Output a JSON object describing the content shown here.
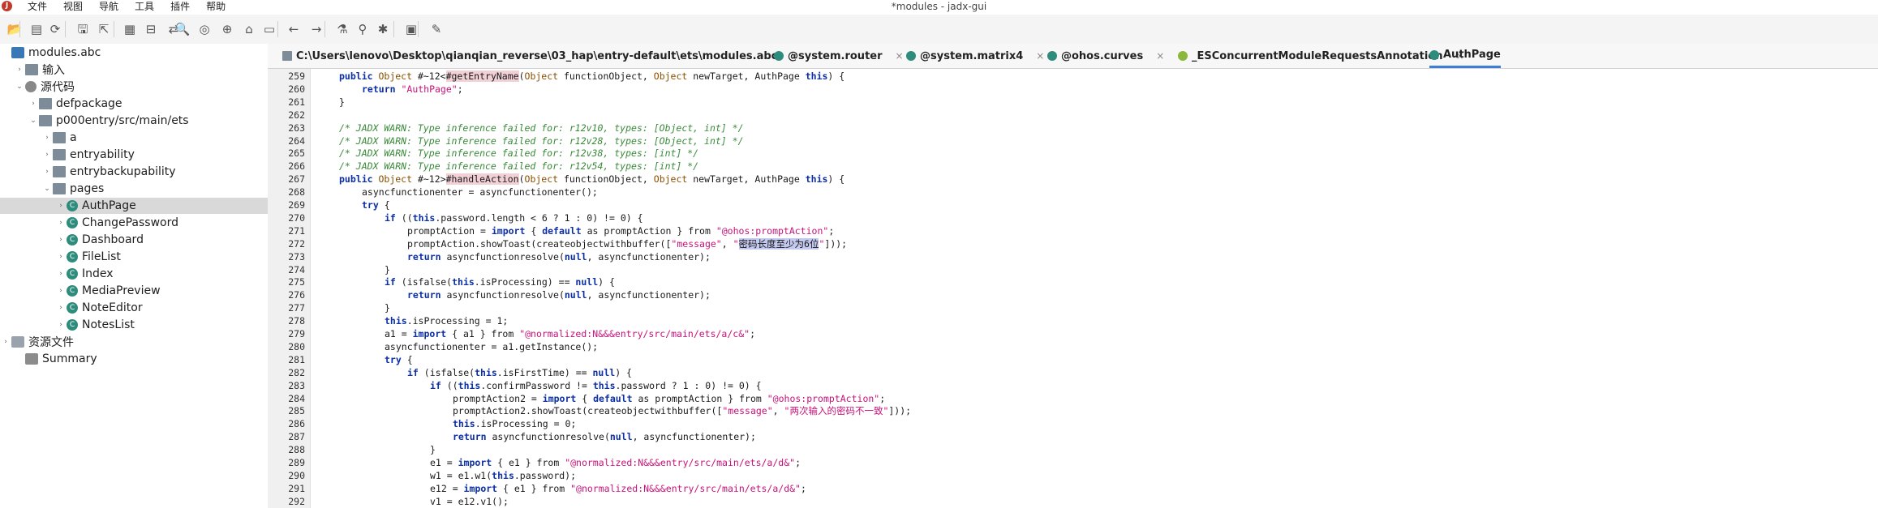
{
  "window": {
    "title": "*modules - jadx-gui",
    "app_icon_letter": "J"
  },
  "menu": [
    "文件",
    "视图",
    "导航",
    "工具",
    "插件",
    "帮助"
  ],
  "toolbar_icons": [
    "open-file-icon",
    "add-files-icon",
    "reload-icon",
    "save-all-icon",
    "export-icon",
    "preferences-icon",
    "flatten-packages-icon",
    "sync-tree-icon",
    "search-icon",
    "find-class-icon",
    "find-usages-icon",
    "home-icon",
    "log-viewer-icon",
    "back-icon",
    "forward-icon",
    "quark-icon",
    "deobfuscation-icon",
    "debug-icon",
    "decompile-all-icon",
    "settings-icon"
  ],
  "sidebar": {
    "items": [
      {
        "label": "modules.abc",
        "icon": "file",
        "arrow": "",
        "indent": 0
      },
      {
        "label": "输入",
        "icon": "folder",
        "arrow": "›",
        "indent": 1
      },
      {
        "label": "源代码",
        "icon": "gear",
        "arrow": "⌄",
        "indent": 1
      },
      {
        "label": "defpackage",
        "icon": "folder",
        "arrow": "›",
        "indent": 2
      },
      {
        "label": "p000entry/src/main/ets",
        "icon": "folder",
        "arrow": "⌄",
        "indent": 2
      },
      {
        "label": "a",
        "icon": "folder",
        "arrow": "›",
        "indent": 3
      },
      {
        "label": "entryability",
        "icon": "folder",
        "arrow": "›",
        "indent": 3
      },
      {
        "label": "entrybackupability",
        "icon": "folder",
        "arrow": "›",
        "indent": 3
      },
      {
        "label": "pages",
        "icon": "folder",
        "arrow": "⌄",
        "indent": 3
      },
      {
        "label": "AuthPage",
        "icon": "cls",
        "arrow": "›",
        "indent": 4,
        "selected": true
      },
      {
        "label": "ChangePassword",
        "icon": "cls",
        "arrow": "›",
        "indent": 4
      },
      {
        "label": "Dashboard",
        "icon": "cls",
        "arrow": "›",
        "indent": 4
      },
      {
        "label": "FileList",
        "icon": "cls",
        "arrow": "›",
        "indent": 4
      },
      {
        "label": "Index",
        "icon": "cls",
        "arrow": "›",
        "indent": 4
      },
      {
        "label": "MediaPreview",
        "icon": "cls",
        "arrow": "›",
        "indent": 4
      },
      {
        "label": "NoteEditor",
        "icon": "cls",
        "arrow": "›",
        "indent": 4
      },
      {
        "label": "NotesList",
        "icon": "cls",
        "arrow": "›",
        "indent": 4
      },
      {
        "label": "资源文件",
        "icon": "res",
        "arrow": "›",
        "indent": 0
      },
      {
        "label": "Summary",
        "icon": "sum",
        "arrow": "",
        "indent": 1
      }
    ]
  },
  "tabs": [
    {
      "label": "C:\\Users\\lenovo\\Desktop\\qianqian_reverse\\03_hap\\entry-default\\ets\\modules.abc",
      "icon_color": "#7e8b99",
      "close": "×"
    },
    {
      "label": "@system.router",
      "icon_color": "#2e8c7c",
      "close": "×"
    },
    {
      "label": "@system.matrix4",
      "icon_color": "#2e8c7c",
      "close": "×"
    },
    {
      "label": "@ohos.curves",
      "icon_color": "#2e8c7c",
      "close": "×"
    },
    {
      "label": "_ESConcurrentModuleRequestsAnnotation",
      "icon_color": "#8bb73a",
      "close": "×"
    },
    {
      "label": "AuthPage",
      "icon_color": "#2e8c7c",
      "close": "",
      "active": true
    }
  ],
  "code_lines": [
    {
      "n": "259",
      "indent": 4,
      "segs": [
        [
          "kw",
          "public "
        ],
        [
          "ty",
          "Object "
        ],
        [
          "t",
          "#~12<"
        ],
        [
          "hl",
          "#getEntryName"
        ],
        [
          "t",
          "("
        ],
        [
          "ty",
          "Object "
        ],
        [
          "t",
          "functionObject, "
        ],
        [
          "ty",
          "Object "
        ],
        [
          "t",
          "newTarget, AuthPage "
        ],
        [
          "kw",
          "this"
        ],
        [
          "t",
          ") {"
        ]
      ]
    },
    {
      "n": "260",
      "indent": 8,
      "segs": [
        [
          "kw",
          "return "
        ],
        [
          "st",
          "\"AuthPage\""
        ],
        [
          "t",
          ";"
        ]
      ]
    },
    {
      "n": "261",
      "indent": 4,
      "segs": [
        [
          "t",
          "}"
        ]
      ]
    },
    {
      "n": "262",
      "indent": 0,
      "segs": []
    },
    {
      "n": "263",
      "indent": 4,
      "segs": [
        [
          "cm",
          "/* JADX WARN: Type inference failed for: r12v10, types: [Object, int] */"
        ]
      ]
    },
    {
      "n": "264",
      "indent": 4,
      "segs": [
        [
          "cm",
          "/* JADX WARN: Type inference failed for: r12v28, types: [Object, int] */"
        ]
      ]
    },
    {
      "n": "265",
      "indent": 4,
      "segs": [
        [
          "cm",
          "/* JADX WARN: Type inference failed for: r12v38, types: [int] */"
        ]
      ]
    },
    {
      "n": "266",
      "indent": 4,
      "segs": [
        [
          "cm",
          "/* JADX WARN: Type inference failed for: r12v54, types: [int] */"
        ]
      ]
    },
    {
      "n": "267",
      "indent": 4,
      "segs": [
        [
          "kw",
          "public "
        ],
        [
          "ty",
          "Object "
        ],
        [
          "t",
          "#~12>"
        ],
        [
          "hl",
          "#handleAction"
        ],
        [
          "t",
          "("
        ],
        [
          "ty",
          "Object "
        ],
        [
          "t",
          "functionObject, "
        ],
        [
          "ty",
          "Object "
        ],
        [
          "t",
          "newTarget, AuthPage "
        ],
        [
          "kw",
          "this"
        ],
        [
          "t",
          ") {"
        ]
      ]
    },
    {
      "n": "268",
      "indent": 8,
      "segs": [
        [
          "t",
          "asyncfunctionenter = asyncfunctionenter();"
        ]
      ]
    },
    {
      "n": "269",
      "indent": 8,
      "segs": [
        [
          "kw",
          "try "
        ],
        [
          "t",
          "{"
        ]
      ]
    },
    {
      "n": "270",
      "indent": 12,
      "segs": [
        [
          "kw",
          "if "
        ],
        [
          "t",
          "(("
        ],
        [
          "kw",
          "this"
        ],
        [
          "t",
          ".password.length < 6 ? 1 : 0) != 0) {"
        ]
      ]
    },
    {
      "n": "271",
      "indent": 16,
      "segs": [
        [
          "t",
          "promptAction = "
        ],
        [
          "kw",
          "import "
        ],
        [
          "t",
          "{ "
        ],
        [
          "kw",
          "default "
        ],
        [
          "t",
          "as promptAction } from "
        ],
        [
          "st",
          "\"@ohos:promptAction\""
        ],
        [
          "t",
          ";"
        ]
      ]
    },
    {
      "n": "272",
      "indent": 16,
      "segs": [
        [
          "t",
          "promptAction.showToast(createobjectwithbuffer(["
        ],
        [
          "st",
          "\"message\""
        ],
        [
          "t",
          ", "
        ],
        [
          "st",
          "\""
        ],
        [
          "ss",
          "密码长度至少为6位"
        ],
        [
          "st",
          "\""
        ],
        [
          "t",
          "]));"
        ]
      ]
    },
    {
      "n": "273",
      "indent": 16,
      "segs": [
        [
          "kw",
          "return "
        ],
        [
          "t",
          "asyncfunctionresolve("
        ],
        [
          "kw",
          "null"
        ],
        [
          "t",
          ", asyncfunctionenter);"
        ]
      ]
    },
    {
      "n": "274",
      "indent": 12,
      "segs": [
        [
          "t",
          "}"
        ]
      ]
    },
    {
      "n": "275",
      "indent": 12,
      "segs": [
        [
          "kw",
          "if "
        ],
        [
          "t",
          "(isfalse("
        ],
        [
          "kw",
          "this"
        ],
        [
          "t",
          ".isProcessing) == "
        ],
        [
          "kw",
          "null"
        ],
        [
          "t",
          ") {"
        ]
      ]
    },
    {
      "n": "276",
      "indent": 16,
      "segs": [
        [
          "kw",
          "return "
        ],
        [
          "t",
          "asyncfunctionresolve("
        ],
        [
          "kw",
          "null"
        ],
        [
          "t",
          ", asyncfunctionenter);"
        ]
      ]
    },
    {
      "n": "277",
      "indent": 12,
      "segs": [
        [
          "t",
          "}"
        ]
      ]
    },
    {
      "n": "278",
      "indent": 12,
      "segs": [
        [
          "kw",
          "this"
        ],
        [
          "t",
          ".isProcessing = 1;"
        ]
      ]
    },
    {
      "n": "279",
      "indent": 12,
      "segs": [
        [
          "t",
          "a1 = "
        ],
        [
          "kw",
          "import "
        ],
        [
          "t",
          "{ a1 } from "
        ],
        [
          "st",
          "\"@normalized:N&&&entry/src/main/ets/a/c&\""
        ],
        [
          "t",
          ";"
        ]
      ]
    },
    {
      "n": "280",
      "indent": 12,
      "segs": [
        [
          "t",
          "asyncfunctionenter = a1.getInstance();"
        ]
      ]
    },
    {
      "n": "281",
      "indent": 12,
      "segs": [
        [
          "kw",
          "try "
        ],
        [
          "t",
          "{"
        ]
      ]
    },
    {
      "n": "282",
      "indent": 16,
      "segs": [
        [
          "kw",
          "if "
        ],
        [
          "t",
          "(isfalse("
        ],
        [
          "kw",
          "this"
        ],
        [
          "t",
          ".isFirstTime) == "
        ],
        [
          "kw",
          "null"
        ],
        [
          "t",
          ") {"
        ]
      ]
    },
    {
      "n": "283",
      "indent": 20,
      "segs": [
        [
          "kw",
          "if "
        ],
        [
          "t",
          "(("
        ],
        [
          "kw",
          "this"
        ],
        [
          "t",
          ".confirmPassword != "
        ],
        [
          "kw",
          "this"
        ],
        [
          "t",
          ".password ? 1 : 0) != 0) {"
        ]
      ]
    },
    {
      "n": "284",
      "indent": 24,
      "segs": [
        [
          "t",
          "promptAction2 = "
        ],
        [
          "kw",
          "import "
        ],
        [
          "t",
          "{ "
        ],
        [
          "kw",
          "default "
        ],
        [
          "t",
          "as promptAction } from "
        ],
        [
          "st",
          "\"@ohos:promptAction\""
        ],
        [
          "t",
          ";"
        ]
      ]
    },
    {
      "n": "285",
      "indent": 24,
      "segs": [
        [
          "t",
          "promptAction2.showToast(createobjectwithbuffer(["
        ],
        [
          "st",
          "\"message\""
        ],
        [
          "t",
          ", "
        ],
        [
          "st",
          "\"两次输入的密码不一致\""
        ],
        [
          "t",
          "]));"
        ]
      ]
    },
    {
      "n": "286",
      "indent": 24,
      "segs": [
        [
          "kw",
          "this"
        ],
        [
          "t",
          ".isProcessing = 0;"
        ]
      ]
    },
    {
      "n": "287",
      "indent": 24,
      "segs": [
        [
          "kw",
          "return "
        ],
        [
          "t",
          "asyncfunctionresolve("
        ],
        [
          "kw",
          "null"
        ],
        [
          "t",
          ", asyncfunctionenter);"
        ]
      ]
    },
    {
      "n": "288",
      "indent": 20,
      "segs": [
        [
          "t",
          "}"
        ]
      ]
    },
    {
      "n": "289",
      "indent": 20,
      "segs": [
        [
          "t",
          "e1 = "
        ],
        [
          "kw",
          "import "
        ],
        [
          "t",
          "{ e1 } from "
        ],
        [
          "st",
          "\"@normalized:N&&&entry/src/main/ets/a/d&\""
        ],
        [
          "t",
          ";"
        ]
      ]
    },
    {
      "n": "290",
      "indent": 20,
      "segs": [
        [
          "t",
          "w1 = e1.w1("
        ],
        [
          "kw",
          "this"
        ],
        [
          "t",
          ".password);"
        ]
      ]
    },
    {
      "n": "291",
      "indent": 20,
      "segs": [
        [
          "t",
          "e12 = "
        ],
        [
          "kw",
          "import "
        ],
        [
          "t",
          "{ e1 } from "
        ],
        [
          "st",
          "\"@normalized:N&&&entry/src/main/ets/a/d&\""
        ],
        [
          "t",
          ";"
        ]
      ]
    },
    {
      "n": "292",
      "indent": 20,
      "segs": [
        [
          "t",
          "v1 = e12.v1();"
        ]
      ]
    }
  ]
}
